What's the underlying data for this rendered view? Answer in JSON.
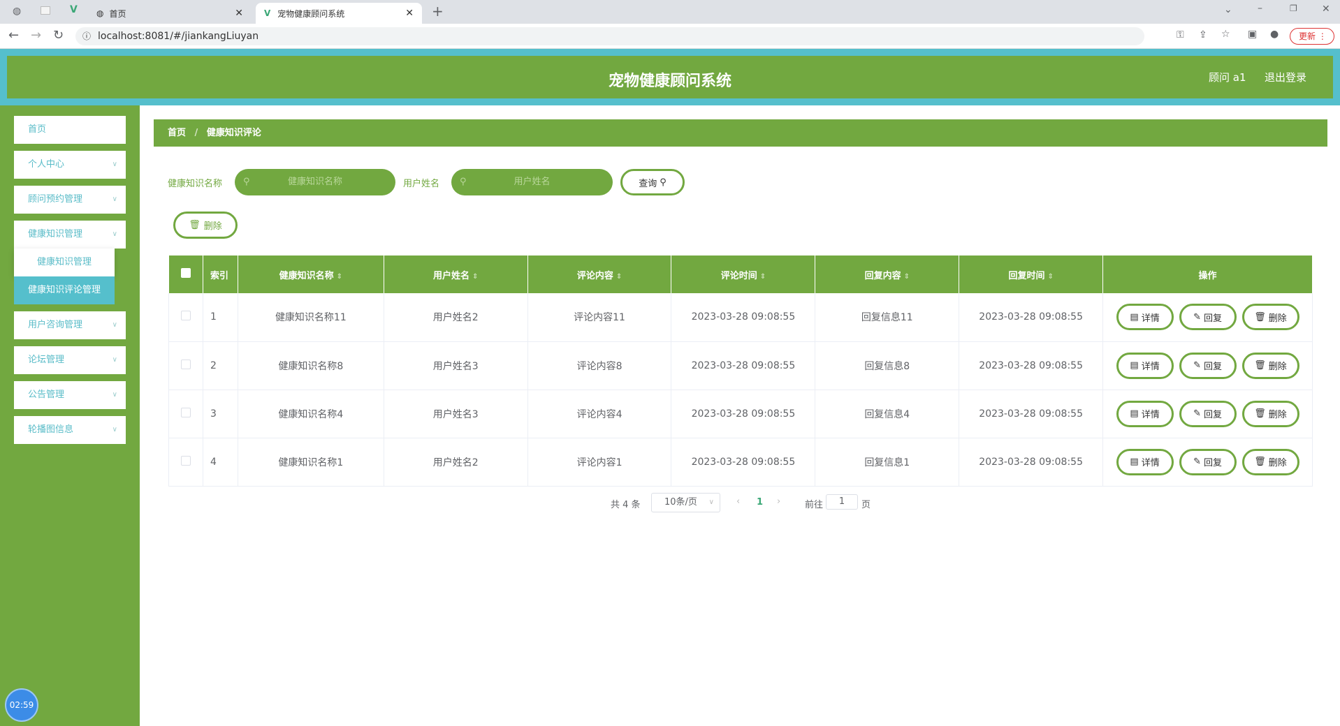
{
  "browser": {
    "tabs": [
      {
        "label": "首页"
      },
      {
        "label": "宠物健康顾问系统"
      }
    ],
    "url": "localhost:8081/#/jiankangLiuyan",
    "update_label": "更新"
  },
  "header": {
    "title": "宠物健康顾问系统",
    "user": "顾问 a1",
    "logout": "退出登录"
  },
  "sidebar": {
    "items": [
      {
        "label": "首页"
      },
      {
        "label": "个人中心"
      },
      {
        "label": "顾问预约管理"
      },
      {
        "label": "健康知识管理"
      },
      {
        "label": "用户咨询管理"
      },
      {
        "label": "论坛管理"
      },
      {
        "label": "公告管理"
      },
      {
        "label": "轮播图信息"
      }
    ],
    "submenu": [
      {
        "label": "健康知识管理"
      },
      {
        "label": "健康知识评论管理"
      }
    ]
  },
  "breadcrumb": {
    "home": "首页",
    "sep": "/",
    "current": "健康知识评论"
  },
  "search": {
    "label1": "健康知识名称",
    "placeholder1": "健康知识名称",
    "label2": "用户姓名",
    "placeholder2": "用户姓名",
    "query": "查询"
  },
  "toolbar": {
    "delete": "删除"
  },
  "table": {
    "headers": [
      "索引",
      "健康知识名称",
      "用户姓名",
      "评论内容",
      "评论时间",
      "回复内容",
      "回复时间",
      "操作"
    ],
    "rows": [
      [
        "1",
        "健康知识名称11",
        "用户姓名2",
        "评论内容11",
        "2023-03-28 09:08:55",
        "回复信息11",
        "2023-03-28 09:08:55"
      ],
      [
        "2",
        "健康知识名称8",
        "用户姓名3",
        "评论内容8",
        "2023-03-28 09:08:55",
        "回复信息8",
        "2023-03-28 09:08:55"
      ],
      [
        "3",
        "健康知识名称4",
        "用户姓名3",
        "评论内容4",
        "2023-03-28 09:08:55",
        "回复信息4",
        "2023-03-28 09:08:55"
      ],
      [
        "4",
        "健康知识名称1",
        "用户姓名2",
        "评论内容1",
        "2023-03-28 09:08:55",
        "回复信息1",
        "2023-03-28 09:08:55"
      ]
    ],
    "actions": {
      "detail": "详情",
      "reply": "回复",
      "delete": "删除"
    }
  },
  "pagination": {
    "total": "共 4 条",
    "page_size": "10条/页",
    "current": "1",
    "goto": "前往",
    "goto_value": "1",
    "page_suffix": "页"
  },
  "clock": "02:59",
  "colors": {
    "primary": "#72a840",
    "accent": "#55bfcc"
  }
}
